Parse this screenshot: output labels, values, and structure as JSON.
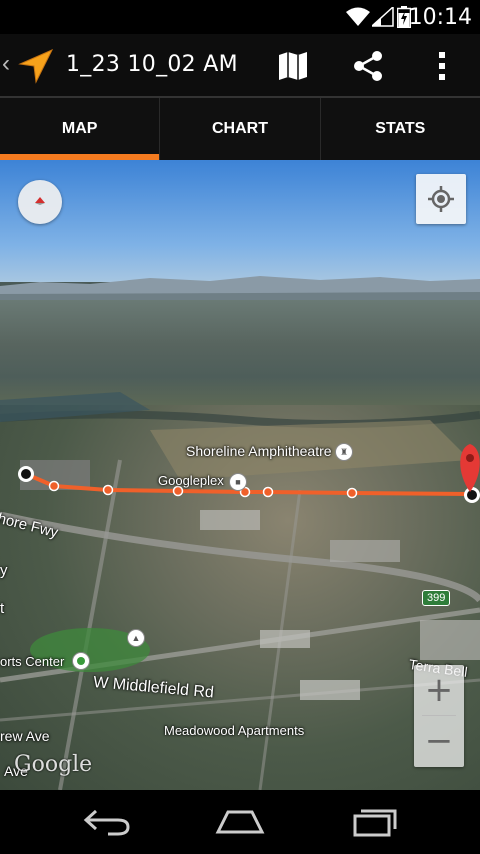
{
  "status_bar": {
    "time": "10:14"
  },
  "action_bar": {
    "title": "1_23 10_02 AM",
    "map_icon": "map-icon",
    "share_icon": "share-icon",
    "overflow_icon": "overflow-menu-icon"
  },
  "tabs": [
    {
      "label": "MAP",
      "active": true
    },
    {
      "label": "CHART",
      "active": false
    },
    {
      "label": "STATS",
      "active": false
    }
  ],
  "map": {
    "labels": {
      "shoreline": "Shoreline Amphitheatre",
      "googleplex": "Googleplex",
      "shoreline_fwy": "hore Fwy",
      "y": "y",
      "t": "t",
      "sports_center": "orts Center",
      "middlefield": "W Middlefield Rd",
      "meadowood": "Meadowood Apartments",
      "drew_ave": "rew Ave",
      "ave": "Ave",
      "terra_bella": "Terra Bell",
      "highway": "399"
    },
    "watermark": "Google",
    "zoom_in": "+",
    "zoom_out": "−",
    "track_color": "#f0602a",
    "end_marker_color": "#e53935"
  },
  "colors": {
    "accent": "#f47b20",
    "tab_bg": "#101010",
    "action_bar_bg": "#0d0d0d"
  }
}
